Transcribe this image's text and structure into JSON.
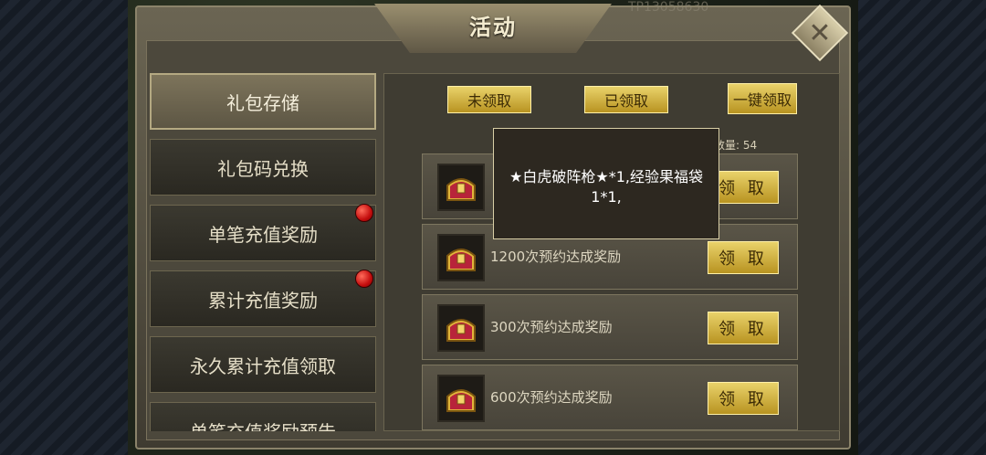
{
  "window": {
    "title": "活动",
    "watermark": "TP13058630"
  },
  "close_icon": "✕",
  "sidebar": {
    "items": [
      {
        "label": "礼包存储",
        "active": true,
        "badge": false
      },
      {
        "label": "礼包码兑换",
        "active": false,
        "badge": false
      },
      {
        "label": "单笔充值奖励",
        "active": false,
        "badge": true
      },
      {
        "label": "累计充值奖励",
        "active": false,
        "badge": true
      },
      {
        "label": "永久累计充值领取",
        "active": false,
        "badge": false
      },
      {
        "label": "单笔充值奖励预告",
        "active": false,
        "badge": false
      }
    ]
  },
  "filters": {
    "unclaimed": "未领取",
    "claimed": "已领取",
    "claim_all": "一键领取"
  },
  "count_text": "数量: 54",
  "rewards": [
    {
      "label": "",
      "claim": "领 取"
    },
    {
      "label": "1200次预约达成奖励",
      "claim": "领 取"
    },
    {
      "label": "300次预约达成奖励",
      "claim": "领 取"
    },
    {
      "label": "600次预约达成奖励",
      "claim": "领 取"
    }
  ],
  "tooltip": {
    "text": "★白虎破阵枪★*1,经验果福袋1*1,"
  },
  "colors": {
    "gold": "#e9d26a",
    "badge_red": "#c40e0e",
    "panel": "#4c483c"
  }
}
